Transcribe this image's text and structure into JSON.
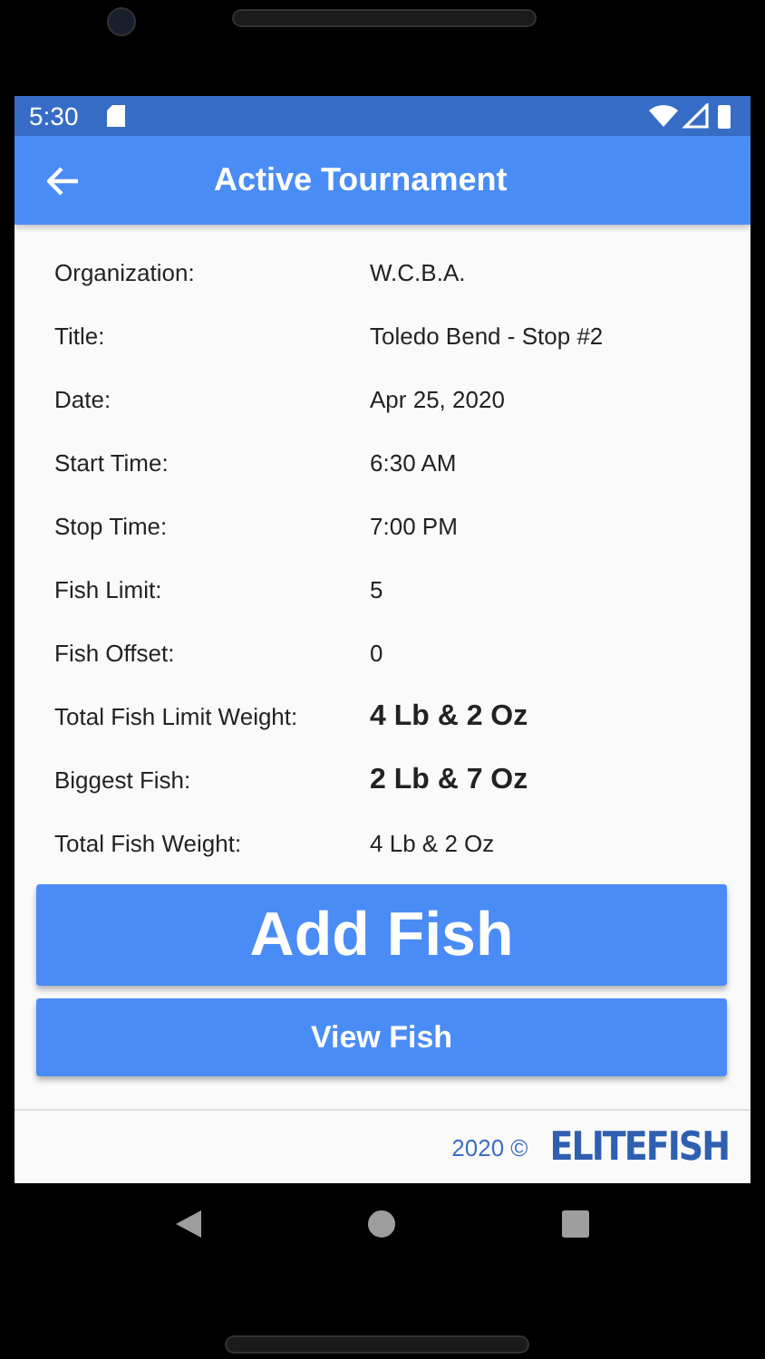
{
  "status_bar": {
    "time": "5:30"
  },
  "app_bar": {
    "title": "Active Tournament"
  },
  "details": [
    {
      "label": "Organization:",
      "value": "W.C.B.A.",
      "emphasis": false
    },
    {
      "label": "Title:",
      "value": "Toledo Bend - Stop #2",
      "emphasis": false
    },
    {
      "label": "Date:",
      "value": "Apr 25, 2020",
      "emphasis": false
    },
    {
      "label": "Start Time:",
      "value": "6:30 AM",
      "emphasis": false
    },
    {
      "label": "Stop Time:",
      "value": "7:00 PM",
      "emphasis": false
    },
    {
      "label": "Fish Limit:",
      "value": "5",
      "emphasis": false
    },
    {
      "label": "Fish Offset:",
      "value": "0",
      "emphasis": false
    },
    {
      "label": "Total Fish Limit Weight:",
      "value": "4 Lb & 2 Oz",
      "emphasis": true
    },
    {
      "label": "Biggest Fish:",
      "value": "2 Lb & 7 Oz",
      "emphasis": true
    },
    {
      "label": "Total Fish Weight:",
      "value": "4 Lb & 2 Oz",
      "emphasis": false
    }
  ],
  "buttons": [
    {
      "label": "Add Fish",
      "kind": "primary"
    },
    {
      "label": "View Fish",
      "kind": "secondary"
    }
  ],
  "footer": {
    "copyright": "2020 ©",
    "logo": "ELITEFISH"
  }
}
